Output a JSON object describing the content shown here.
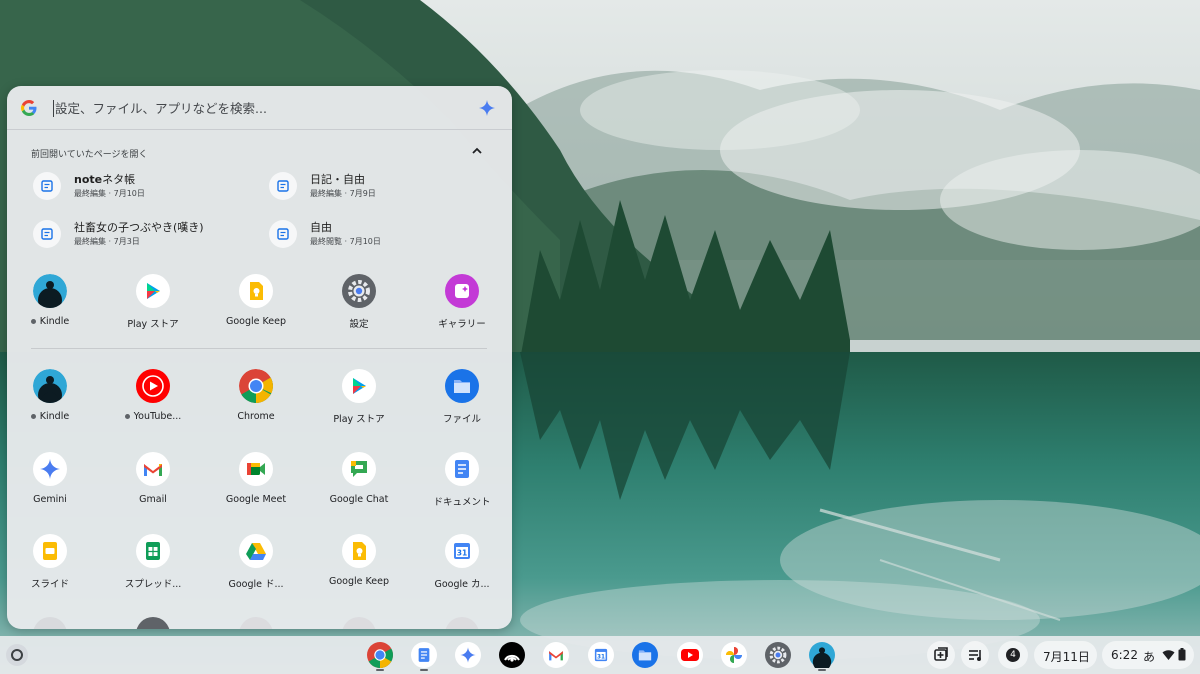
{
  "search": {
    "placeholder": "設定、ファイル、アプリなどを検索..."
  },
  "recent": {
    "title": "前回開いていたページを開く",
    "items": [
      {
        "title_bold": "note",
        "title_rest": "ネタ帳",
        "subtitle": "最終編集 · 7月10日"
      },
      {
        "title_bold": "",
        "title_rest": "日記・自由",
        "subtitle": "最終編集 · 7月9日"
      },
      {
        "title_bold": "",
        "title_rest": "社畜女の子つぶやき(嘆き)",
        "subtitle": "最終編集 · 7月3日"
      },
      {
        "title_bold": "",
        "title_rest": "自由",
        "subtitle": "最終閲覧 · 7月10日"
      }
    ]
  },
  "suggested_apps": [
    {
      "label": "Kindle",
      "icon": "kindle-icon",
      "dot": true
    },
    {
      "label": "Play ストア",
      "icon": "play-store-icon",
      "dot": false
    },
    {
      "label": "Google Keep",
      "icon": "keep-icon",
      "dot": false
    },
    {
      "label": "設定",
      "icon": "settings-icon",
      "dot": false
    },
    {
      "label": "ギャラリー",
      "icon": "gallery-icon",
      "dot": false
    }
  ],
  "apps": [
    {
      "label": "Kindle",
      "icon": "kindle-icon",
      "dot": true
    },
    {
      "label": "YouTube...",
      "icon": "youtube-music-icon",
      "dot": true
    },
    {
      "label": "Chrome",
      "icon": "chrome-icon",
      "dot": false
    },
    {
      "label": "Play ストア",
      "icon": "play-store-icon",
      "dot": false
    },
    {
      "label": "ファイル",
      "icon": "files-icon",
      "dot": false
    },
    {
      "label": "Gemini",
      "icon": "gemini-icon",
      "dot": false
    },
    {
      "label": "Gmail",
      "icon": "gmail-icon",
      "dot": false
    },
    {
      "label": "Google Meet",
      "icon": "meet-icon",
      "dot": false
    },
    {
      "label": "Google Chat",
      "icon": "chat-icon",
      "dot": false
    },
    {
      "label": "ドキュメント",
      "icon": "docs-icon",
      "dot": false
    },
    {
      "label": "スライド",
      "icon": "slides-icon",
      "dot": false
    },
    {
      "label": "スプレッド...",
      "icon": "sheets-icon",
      "dot": false
    },
    {
      "label": "Google ド...",
      "icon": "drive-icon",
      "dot": false
    },
    {
      "label": "Google Keep",
      "icon": "keep-icon",
      "dot": false
    },
    {
      "label": "Google カ...",
      "icon": "calendar-icon",
      "dot": false
    }
  ],
  "shelf": {
    "apps": [
      "chrome-icon",
      "docs-icon",
      "gemini-icon",
      "podcast-icon",
      "gmail-icon",
      "calendar-icon",
      "files-icon",
      "youtube-icon",
      "photos-icon",
      "settings-icon",
      "kindle-icon"
    ],
    "notification_count": "4",
    "date": "7月11日",
    "time": "6:22",
    "ime": "あ"
  },
  "colors": {
    "accent": "#1a73e8",
    "launcher_bg": "#e8eaec",
    "shelf_bg": "#e6e9ec"
  }
}
